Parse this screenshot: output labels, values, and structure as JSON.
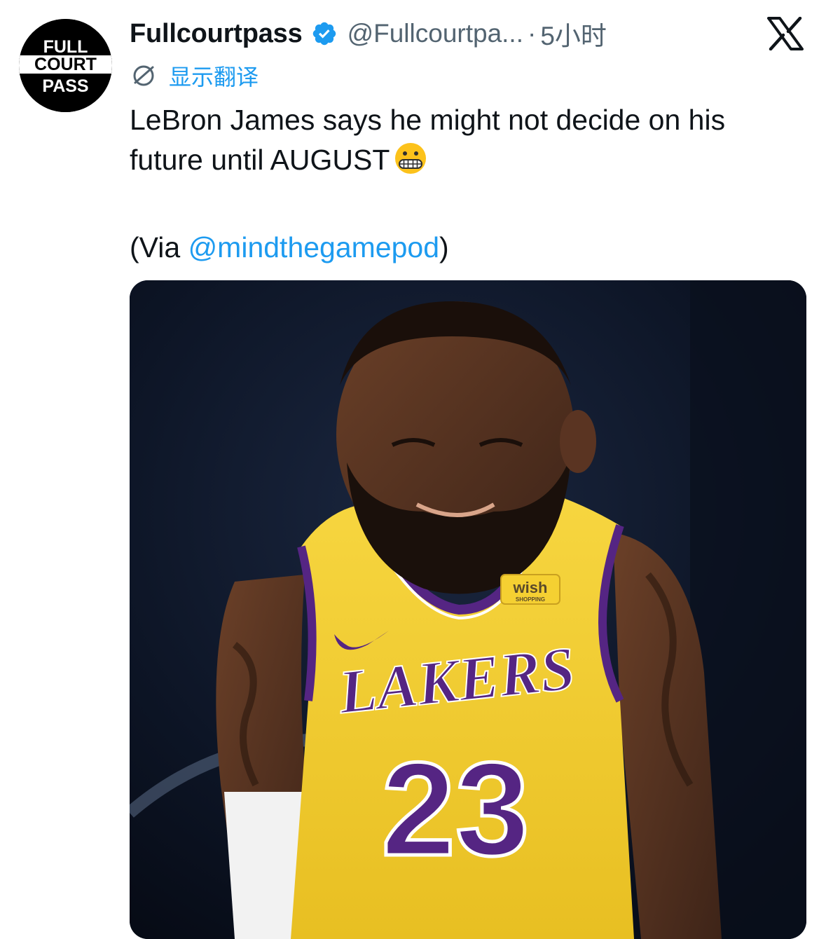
{
  "profile": {
    "avatar_lines": [
      "FULL",
      "COURT",
      "PASS"
    ],
    "name": "Fullcourtpass",
    "handle": "@Fullcourtpa...",
    "separator": "·",
    "time": "5小时",
    "verified_icon": "verified-badge-icon"
  },
  "platform_logo": "x-logo-icon",
  "translate_label": "显示翻译",
  "tweet": {
    "line1": "LeBron James says he might not decide on his",
    "line2": "future until AUGUST",
    "emoji": "grimacing-face",
    "via_prefix": "(Via ",
    "mention": "@mindthegamepod",
    "via_suffix": ")"
  },
  "media": {
    "jersey_sponsor": "wish",
    "jersey_sponsor_sub": "SHOPPING",
    "jersey_team": "LAKERS",
    "jersey_number": "23"
  },
  "colors": {
    "link": "#1d9bf0",
    "secondary_text": "#536471",
    "jersey_gold": "#f5d032",
    "jersey_purple": "#552583"
  }
}
